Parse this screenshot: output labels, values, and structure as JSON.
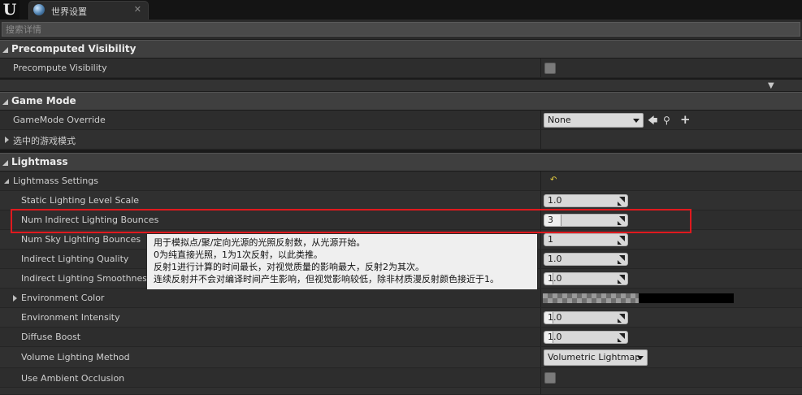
{
  "window": {
    "logo": "U",
    "tab_title": "世界设置",
    "tab_close": "✕"
  },
  "search": {
    "placeholder": "搜索详情"
  },
  "categories": {
    "precomputed": "Precomputed Visibility",
    "gamemode": "Game Mode",
    "lightmass": "Lightmass"
  },
  "rows": {
    "precompute_visibility": "Precompute Visibility",
    "gamemode_override": "GameMode Override",
    "gamemode_override_value": "None",
    "selected_gamemode": "选中的游戏模式",
    "lightmass_settings": "Lightmass Settings",
    "static_lighting_level_scale": "Static Lighting Level Scale",
    "static_lighting_level_scale_value": "1.0",
    "num_indirect_bounces": "Num Indirect Lighting Bounces",
    "num_indirect_bounces_value": "3",
    "num_sky_bounces": "Num Sky Lighting Bounces",
    "num_sky_bounces_value": "1",
    "indirect_quality": "Indirect Lighting Quality",
    "indirect_quality_value": "1.0",
    "indirect_smoothness": "Indirect Lighting Smoothness",
    "indirect_smoothness_value": "1.0",
    "environment_color": "Environment Color",
    "environment_intensity": "Environment Intensity",
    "environment_intensity_value": "1.0",
    "diffuse_boost": "Diffuse Boost",
    "diffuse_boost_value": "1.0",
    "volume_lighting_method": "Volume Lighting Method",
    "volume_lighting_method_value": "Volumetric Lightmap",
    "use_ambient_occlusion": "Use Ambient Occlusion"
  },
  "tooltip": {
    "line1": "用于模拟点/聚/定向光源的光照反射数，从光源开始。",
    "line2": "0为纯直接光照，1为1次反射，以此类推。",
    "line3": "反射1进行计算的时间最长，对视觉质量的影响最大，反射2为其次。",
    "line4": "连续反射并不会对编译时间产生影响，但视觉影响较低，除非材质漫反射颜色接近于1。"
  },
  "colors": {
    "highlight": "#e0191e",
    "panel": "#2d2d2d",
    "header": "#3f3f3f"
  }
}
